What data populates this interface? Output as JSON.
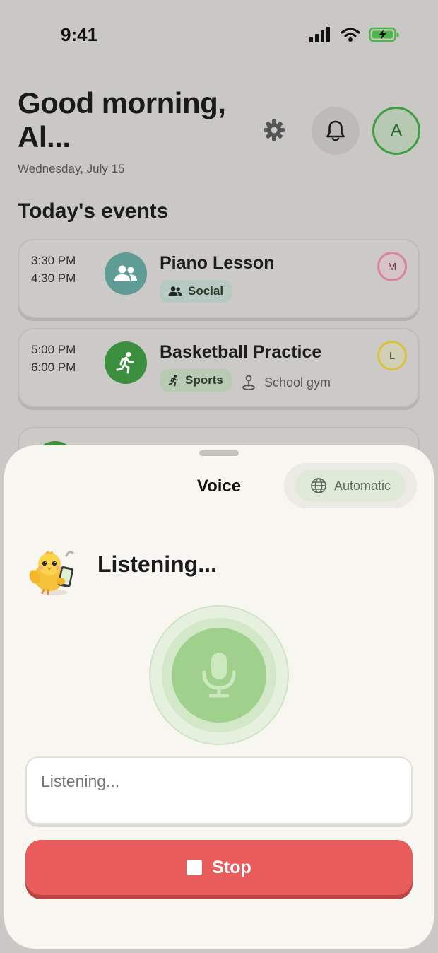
{
  "status_bar": {
    "time": "9:41",
    "icons": [
      "signal-icon",
      "wifi-icon",
      "battery-charging-icon"
    ]
  },
  "header": {
    "greeting": "Good morning, Al...",
    "date": "Wednesday, July 15",
    "settings_icon": "gear-icon",
    "notifications_icon": "bell-icon",
    "avatar_initial": "A"
  },
  "section": {
    "title": "Today's events"
  },
  "events": [
    {
      "start": "3:30 PM",
      "end": "4:30 PM",
      "title": "Piano Lesson",
      "icon": "people-icon",
      "tag": "Social",
      "location": "",
      "assignee": "M",
      "colors": {
        "icon_bg": "#5f9c95",
        "tag_bg": "#b6c9c2",
        "assignee_ring": "#d9839c",
        "assignee_bg": "#d6c4c9",
        "assignee_text": "#6b3a46"
      }
    },
    {
      "start": "5:00 PM",
      "end": "6:00 PM",
      "title": "Basketball Practice",
      "icon": "running-icon",
      "tag": "Sports",
      "location": "School gym",
      "assignee": "L",
      "colors": {
        "icon_bg": "#3c8f3e",
        "tag_bg": "#b8cbb2",
        "assignee_ring": "#d8c23f",
        "assignee_bg": "#d2cfb7",
        "assignee_text": "#5f5826"
      }
    }
  ],
  "voice_sheet": {
    "title": "Voice",
    "language_label": "Automatic",
    "language_icon": "globe-icon",
    "status_heading": "Listening...",
    "mascot": "chick-mascot-icon",
    "mic_icon": "microphone-icon",
    "transcript_placeholder": "Listening...",
    "stop_label": "Stop",
    "colors": {
      "stop": "#e85c5c",
      "mic": "#9fd18d",
      "sheet_bg": "#f8f6f1"
    }
  }
}
